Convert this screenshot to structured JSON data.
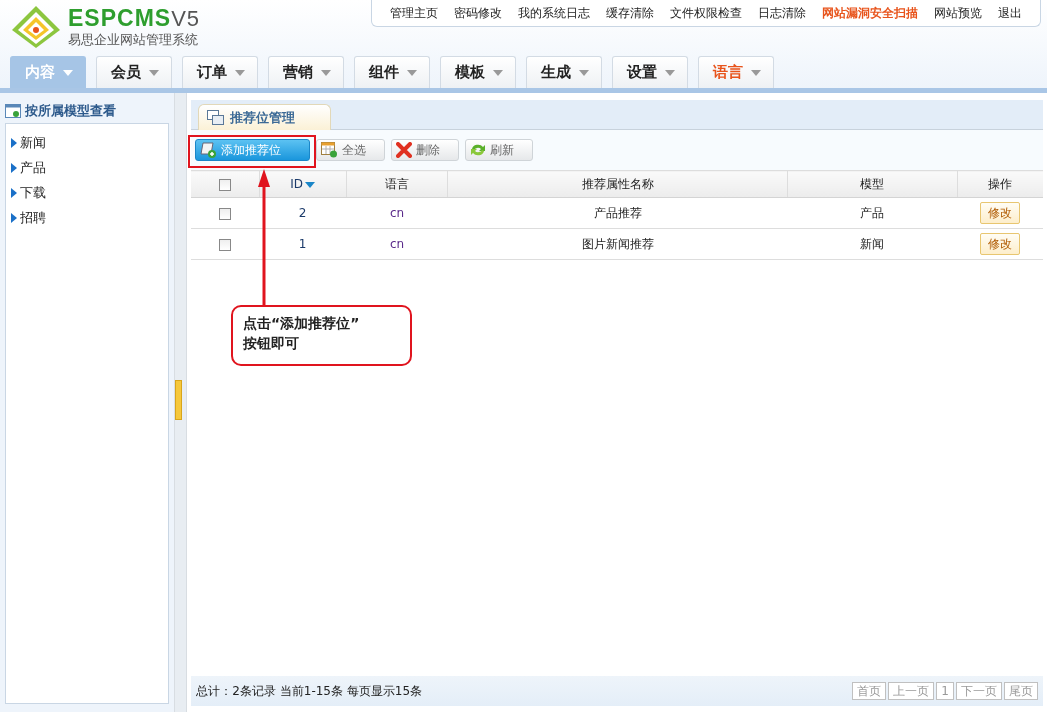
{
  "logo": {
    "brand": "ESPCMS",
    "version": "V5",
    "subtitle": "易思企业网站管理系统"
  },
  "top_links": [
    {
      "label": "管理主页",
      "highlight": false
    },
    {
      "label": "密码修改",
      "highlight": false
    },
    {
      "label": "我的系统日志",
      "highlight": false
    },
    {
      "label": "缓存清除",
      "highlight": false
    },
    {
      "label": "文件权限检查",
      "highlight": false
    },
    {
      "label": "日志清除",
      "highlight": false
    },
    {
      "label": "网站漏洞安全扫描",
      "highlight": true
    },
    {
      "label": "网站预览",
      "highlight": false
    },
    {
      "label": "退出",
      "highlight": false
    }
  ],
  "tabs": [
    {
      "label": "内容",
      "selected": true,
      "highlight": false
    },
    {
      "label": "会员",
      "selected": false,
      "highlight": false
    },
    {
      "label": "订单",
      "selected": false,
      "highlight": false
    },
    {
      "label": "营销",
      "selected": false,
      "highlight": false
    },
    {
      "label": "组件",
      "selected": false,
      "highlight": false
    },
    {
      "label": "模板",
      "selected": false,
      "highlight": false
    },
    {
      "label": "生成",
      "selected": false,
      "highlight": false
    },
    {
      "label": "设置",
      "selected": false,
      "highlight": false
    },
    {
      "label": "语言",
      "selected": false,
      "highlight": true
    }
  ],
  "sidebar": {
    "title": "按所属模型查看",
    "items": [
      "新闻",
      "产品",
      "下载",
      "招聘"
    ]
  },
  "panel_tab": "推荐位管理",
  "toolbar": [
    {
      "label": "添加推荐位",
      "kind": "add",
      "primary": true
    },
    {
      "label": "全选",
      "kind": "select",
      "primary": false
    },
    {
      "label": "删除",
      "kind": "delete",
      "primary": false
    },
    {
      "label": "刷新",
      "kind": "refresh",
      "primary": false
    }
  ],
  "table": {
    "header_checked": false,
    "columns": [
      "",
      "ID",
      "语言",
      "推荐属性名称",
      "模型",
      "操作"
    ],
    "rows": [
      {
        "checked": false,
        "id": "2",
        "lang": "cn",
        "name": "产品推荐",
        "model": "产品",
        "action": "修改"
      },
      {
        "checked": false,
        "id": "1",
        "lang": "cn",
        "name": "图片新闻推荐",
        "model": "新闻",
        "action": "修改"
      }
    ]
  },
  "callout": {
    "lines": [
      "点击“添加推荐位”",
      "按钮即可"
    ]
  },
  "footer": {
    "summary": "总计：2条记录 当前1-15条 每页显示15条",
    "pages": [
      {
        "label": "首页",
        "disabled": true
      },
      {
        "label": "上一页",
        "disabled": true
      },
      {
        "label": "1",
        "disabled": true
      },
      {
        "label": "下一页",
        "disabled": true
      },
      {
        "label": "尾页",
        "disabled": true
      }
    ]
  }
}
